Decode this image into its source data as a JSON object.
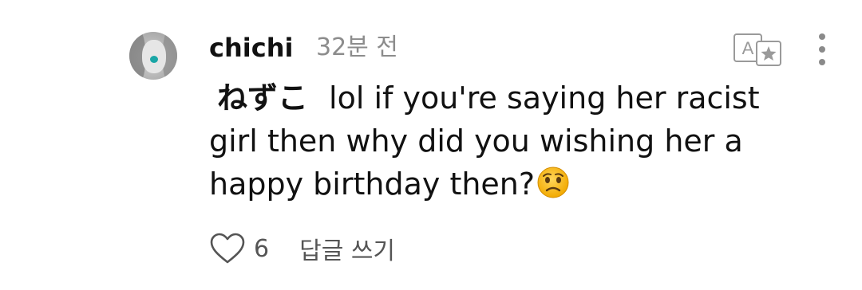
{
  "comment": {
    "username": "chichi",
    "time": "32분 전",
    "mention": "ねずこ",
    "text": "lol if you're saying her racist girl then why did you wishing her a happy birthday then?",
    "emoji": "worried-face",
    "avatar": "avatar"
  },
  "actions": {
    "like_icon": "heart-outline-icon",
    "like_count": "6",
    "reply_label": "답글 쓰기"
  },
  "toolbar": {
    "translate_icon": "translate-icon",
    "more_icon": "more-vertical-icon"
  },
  "colors": {
    "text": "#111111",
    "secondary": "#8c8c8c",
    "icon": "#555555"
  }
}
